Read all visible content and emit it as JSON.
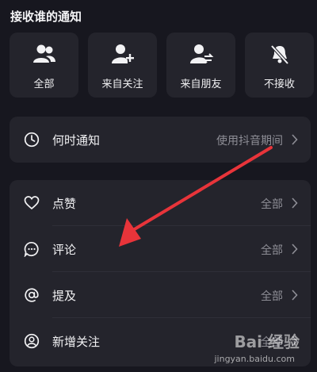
{
  "section": {
    "title": "接收谁的通知"
  },
  "options": [
    {
      "label": "全部",
      "icon": "users-icon"
    },
    {
      "label": "来自关注",
      "icon": "user-add-icon"
    },
    {
      "label": "来自朋友",
      "icon": "user-friend-icon"
    },
    {
      "label": "不接收",
      "icon": "bell-off-icon"
    }
  ],
  "when": {
    "label": "何时通知",
    "value": "使用抖音期间",
    "icon": "clock-icon"
  },
  "rows": [
    {
      "label": "点赞",
      "value": "全部",
      "icon": "heart-icon"
    },
    {
      "label": "评论",
      "value": "全部",
      "icon": "comment-icon"
    },
    {
      "label": "提及",
      "value": "全部",
      "icon": "at-icon"
    },
    {
      "label": "新增关注",
      "value": "全部",
      "icon": "person-circle-icon"
    }
  ],
  "watermark": {
    "brand": "Bai 经验",
    "url": "jingyan.baidu.com"
  },
  "colors": {
    "background": "#17171f",
    "card": "#24242c",
    "arrow": "#e8343a",
    "muted": "#8e8e96"
  }
}
